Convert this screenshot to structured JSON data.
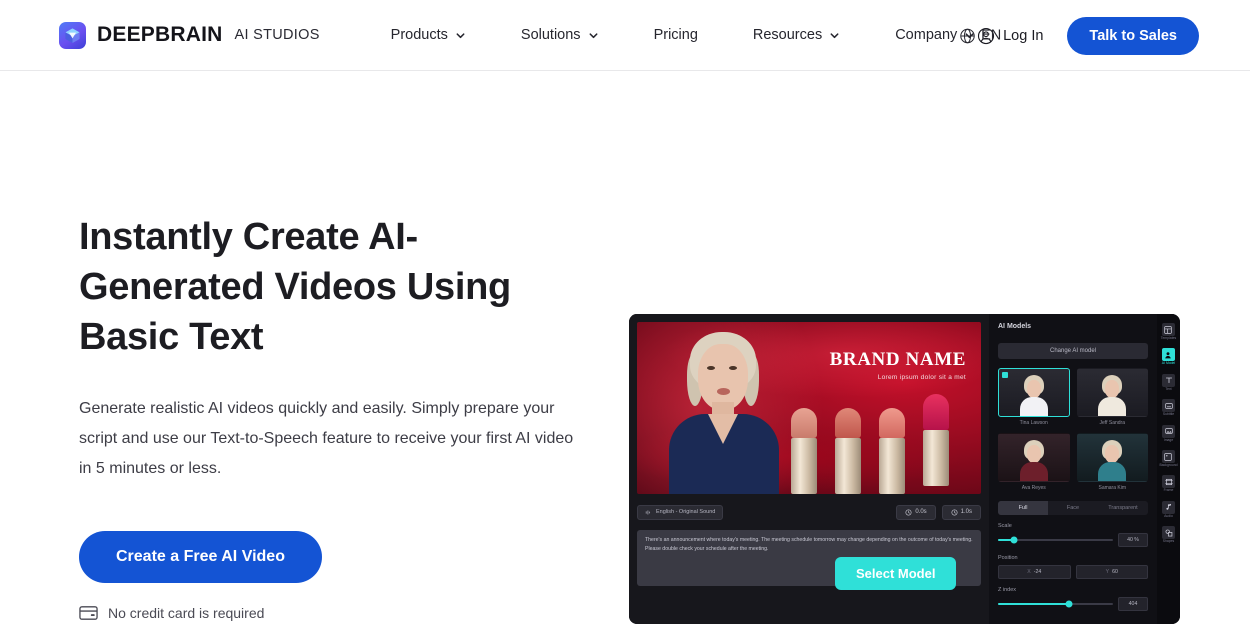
{
  "header": {
    "brand_name": "DEEPBRAIN",
    "brand_sub": "AI STUDIOS",
    "logo_icon": "deepbrain-cube-logo",
    "nav": [
      {
        "label": "Products",
        "icon": "chevron-down-icon",
        "has_caret": true
      },
      {
        "label": "Solutions",
        "icon": "chevron-down-icon",
        "has_caret": true
      },
      {
        "label": "Pricing",
        "icon": "",
        "has_caret": false
      },
      {
        "label": "Resources",
        "icon": "chevron-down-icon",
        "has_caret": true
      },
      {
        "label": "Company",
        "icon": "chevron-down-icon",
        "has_caret": true
      }
    ],
    "language": {
      "label": "EN",
      "icon": "globe-icon"
    },
    "login": {
      "label": "Log In",
      "icon": "user-circle-icon"
    },
    "cta": {
      "label": "Talk to Sales"
    },
    "accent_color": "#1454d4"
  },
  "hero": {
    "headline": "Instantly Create AI-Generated Videos Using Basic Text",
    "subcopy": "Generate realistic AI videos quickly and easily. Simply prepare your script and use our Text-to-Speech feature to receive your first AI video in 5 minutes or less.",
    "cta_label": "Create a Free AI Video",
    "note": {
      "label": "No credit card is required",
      "icon": "credit-card-icon"
    }
  },
  "mock": {
    "canvas": {
      "brand_title": "BRAND NAME",
      "brand_tagline": "Lorem ipsum dolor sit a met",
      "presenter": "ai-avatar-presenter",
      "products": "lipstick-row"
    },
    "toolbar": {
      "audio_chip": {
        "label": "English - Original Sound",
        "icon": "audio-wave-icon"
      },
      "time_chips": [
        {
          "label": "0.0s",
          "icon": "clock-icon"
        },
        {
          "label": "1.0s",
          "icon": "clock-icon"
        }
      ]
    },
    "script_text": "There's an announcement where today's meeting. The meeting schedule tomorrow may change depending on the outcome of today's meeting. Please double check your schedule after the meeting.",
    "select_model_label": "Select Model",
    "panel": {
      "title": "AI Models",
      "change_button": "Change AI model",
      "models": [
        {
          "name": "Tina Lawson",
          "selected": true,
          "body_color": "#f2f2f5"
        },
        {
          "name": "Jeff Sandra",
          "selected": false,
          "body_color": "#efe9de"
        },
        {
          "name": "Ava Reyes",
          "selected": false,
          "body_color": "#6d1f2b"
        },
        {
          "name": "Samara Kim",
          "selected": false,
          "body_color": "#2f7f8c"
        }
      ],
      "tabs": [
        {
          "label": "Full",
          "active": true
        },
        {
          "label": "Face",
          "active": false
        },
        {
          "label": "Transparent",
          "active": false
        }
      ],
      "controls": [
        {
          "label": "Scale",
          "type": "slider",
          "value": "40 %",
          "fill_pct": 14
        },
        {
          "label": "Position",
          "type": "xy",
          "x_axis": "X",
          "x_value": "-24",
          "y_axis": "Y",
          "y_value": "60"
        },
        {
          "label": "Z index",
          "type": "slider",
          "value": "404",
          "fill_pct": 62
        }
      ]
    },
    "rail": [
      {
        "icon": "templates-icon",
        "label": "Templates",
        "active": false
      },
      {
        "icon": "ai-model-icon",
        "label": "AI Model",
        "active": true
      },
      {
        "icon": "text-icon",
        "label": "Text",
        "active": false
      },
      {
        "icon": "subtitle-icon",
        "label": "Subtitle",
        "active": false
      },
      {
        "icon": "image-icon",
        "label": "Image",
        "active": false
      },
      {
        "icon": "background-icon",
        "label": "Background",
        "active": false
      },
      {
        "icon": "frame-icon",
        "label": "Frame",
        "active": false
      },
      {
        "icon": "audio-icon",
        "label": "Audio",
        "active": false
      },
      {
        "icon": "shapes-icon",
        "label": "Shapes",
        "active": false
      }
    ],
    "accent_color": "#2fe0d8"
  }
}
